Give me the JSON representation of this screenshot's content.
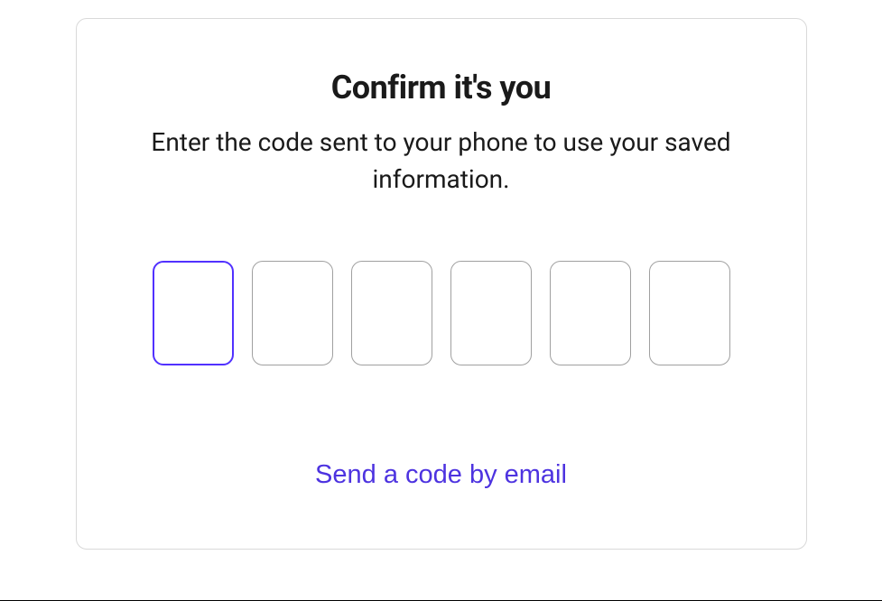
{
  "dialog": {
    "heading": "Confirm it's you",
    "description": "Enter the code sent to your phone to use your saved information.",
    "code": {
      "digit_count": 6,
      "values": [
        "",
        "",
        "",
        "",
        "",
        ""
      ],
      "focused_index": 0
    },
    "resend_link_label": "Send a code by email"
  }
}
